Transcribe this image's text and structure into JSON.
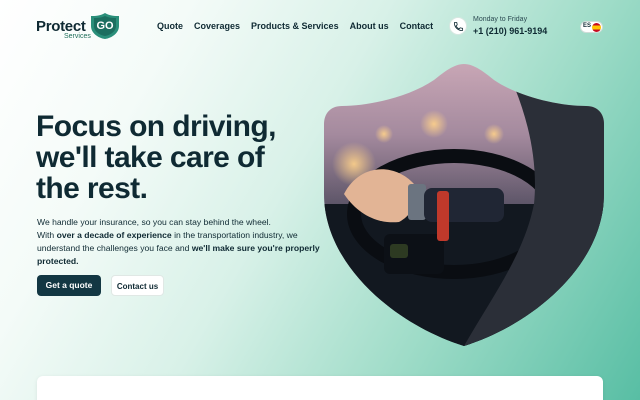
{
  "brand": {
    "name_main": "Protect",
    "name_accent": "GO",
    "name_sub": "Services"
  },
  "nav": {
    "items": [
      "Quote",
      "Coverages",
      "Products & Services",
      "About us",
      "Contact"
    ]
  },
  "contact": {
    "hours": "Monday to Friday",
    "phone": "+1 (210) 961-9194",
    "phone_icon": "phone-icon"
  },
  "language": {
    "code": "ES",
    "flag_icon": "spain-flag-icon"
  },
  "hero": {
    "headline_lines": [
      "Focus on driving,",
      "we'll take care of",
      "the rest."
    ],
    "paragraph": {
      "line1": "We handle your insurance, so you can stay behind the wheel.",
      "line2_pre": "With ",
      "line2_bold": "over a decade of experience",
      "line2_post": " in the transportation industry, we",
      "line3_pre": "understand the challenges you face and ",
      "line3_bold": "we'll make sure you're properly",
      "line4_bold": "protected."
    },
    "primary_button": "Get a quote",
    "secondary_button": "Contact us",
    "image_icon": "driver-steering-wheel-photo"
  },
  "colors": {
    "primary": "#133743",
    "accent": "#1f8f74",
    "text": "#0f2a33"
  }
}
